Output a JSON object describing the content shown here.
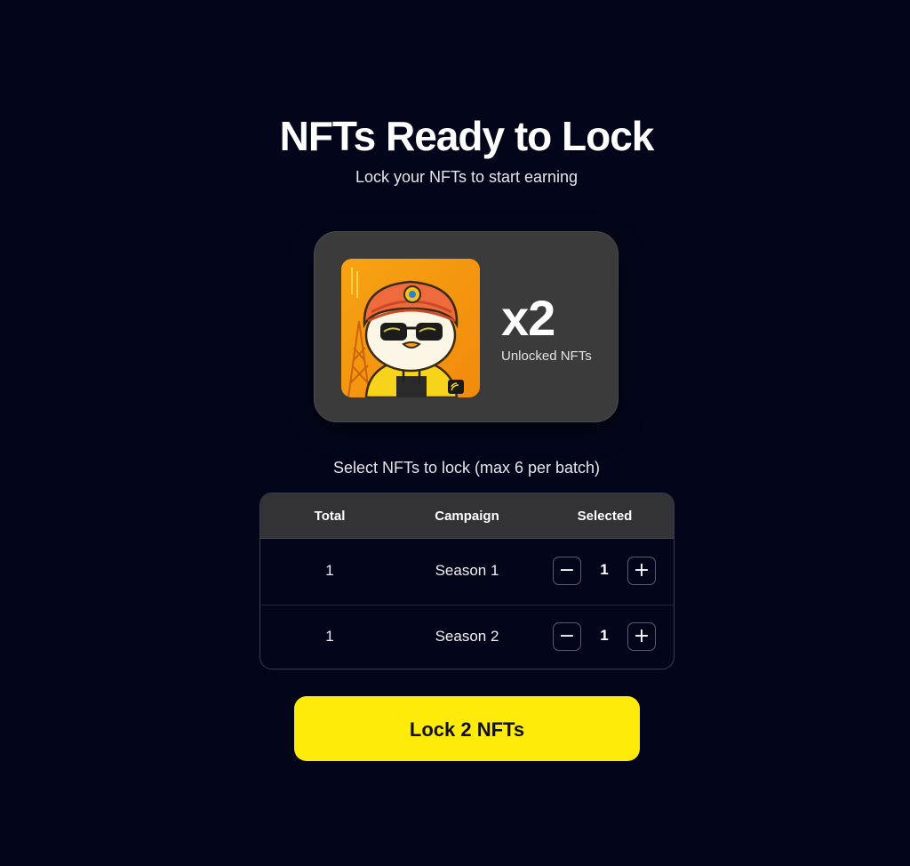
{
  "header": {
    "title": "NFTs Ready to Lock",
    "subtitle": "Lock your NFTs to start earning"
  },
  "nft_summary": {
    "count": "x2",
    "label": "Unlocked NFTs",
    "image_icon": "penguin-avatar-turban-sunglasses"
  },
  "instruction": "Select NFTs to lock (max 6 per batch)",
  "table": {
    "headers": [
      "Total",
      "Campaign",
      "Selected"
    ],
    "rows": [
      {
        "total": "1",
        "campaign": "Season 1",
        "selected": "1"
      },
      {
        "total": "1",
        "campaign": "Season 2",
        "selected": "1"
      }
    ],
    "minus_symbol": "−",
    "plus_symbol": "+"
  },
  "action": {
    "lock_label": "Lock 2 NFTs"
  },
  "colors": {
    "background": "#03061a",
    "card": "#3c3b3c",
    "accent": "#ffeb0a"
  }
}
